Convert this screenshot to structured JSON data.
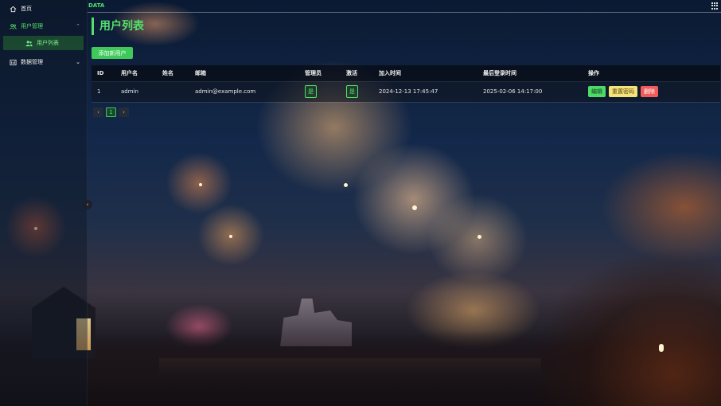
{
  "brand": "DATA",
  "sidebar": {
    "items": [
      {
        "label": "首页",
        "icon": "home-icon"
      },
      {
        "label": "用户管理",
        "icon": "users-icon",
        "expanded": true
      },
      {
        "label": "用户列表",
        "icon": "user-list-icon",
        "active": true
      },
      {
        "label": "数据管理",
        "icon": "data-icon"
      }
    ]
  },
  "page": {
    "title": "用户列表",
    "add_button": "添加新用户"
  },
  "table": {
    "headers": {
      "id": "ID",
      "username": "用户名",
      "name": "姓名",
      "email": "邮箱",
      "admin": "管理员",
      "active": "激活",
      "joined": "加入时间",
      "last_login": "最后登录时间",
      "actions": "操作"
    },
    "rows": [
      {
        "id": "1",
        "username": "admin",
        "name": "",
        "email": "admin@example.com",
        "admin": "是",
        "active": "是",
        "joined": "2024-12-13 17:45:47",
        "last_login": "2025-02-06 14:17:00",
        "actions": {
          "edit": "编辑",
          "reset": "重置密码",
          "delete": "删除"
        }
      }
    ]
  },
  "pagination": {
    "prev": "‹",
    "current": "1",
    "next": "›"
  },
  "colors": {
    "accent": "#52e06a",
    "danger": "#f25b5b",
    "warning": "#f4e27a"
  }
}
